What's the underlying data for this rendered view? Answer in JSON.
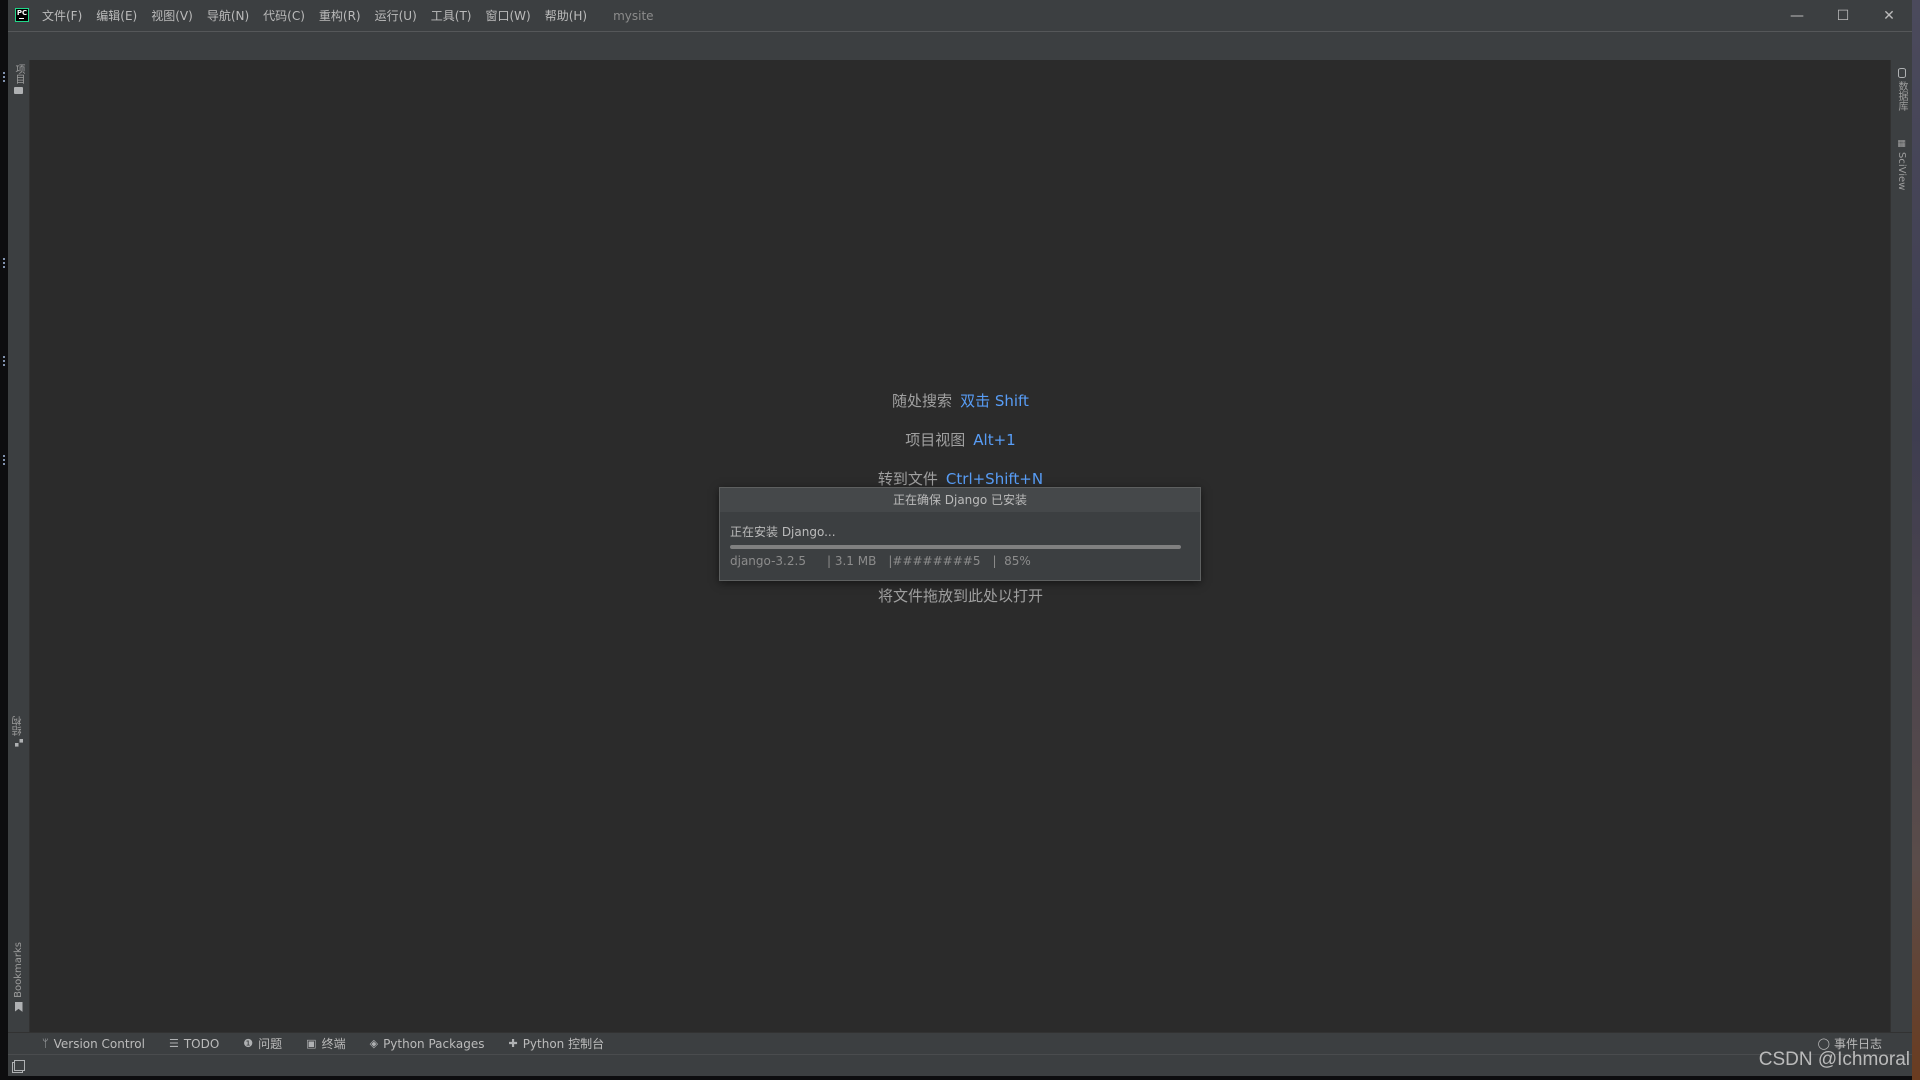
{
  "titlebar": {
    "logo_text": "PC",
    "menu": [
      "文件(F)",
      "编辑(E)",
      "视图(V)",
      "导航(N)",
      "代码(C)",
      "重构(R)",
      "运行(U)",
      "工具(T)",
      "窗口(W)",
      "帮助(H)"
    ],
    "project_name": "mysite",
    "controls": {
      "minimize": "—",
      "maximize": "☐",
      "close": "✕"
    }
  },
  "left_stripe": {
    "top": {
      "label": "项目",
      "icon": "folder-icon"
    },
    "bottom": [
      {
        "label": "结构",
        "icon": "structure-icon"
      },
      {
        "label": "Bookmarks",
        "icon": "bookmark-icon"
      }
    ]
  },
  "right_stripe": [
    {
      "label": "数据库",
      "icon": "database-icon"
    },
    {
      "label": "SciView",
      "icon": "grid-icon"
    }
  ],
  "editor_hints": [
    {
      "label": "随处搜索",
      "shortcut": "双击 Shift"
    },
    {
      "label": "项目视图",
      "shortcut": "Alt+1"
    },
    {
      "label": "转到文件",
      "shortcut": "Ctrl+Shift+N"
    },
    {
      "label": "将文件拖放到此处以打开",
      "shortcut": ""
    }
  ],
  "dialog": {
    "title": "正在确保 Django 已安装",
    "status": "正在安装 Django...",
    "progress_percent": 100,
    "detail": {
      "package": "django-3.2.5",
      "size": "| 3.1 MB",
      "bar": "|########5",
      "percent": "|  85%"
    }
  },
  "bottom_toolbar": [
    {
      "label": "Version Control",
      "icon": "branch-icon",
      "glyph": "ᛘ"
    },
    {
      "label": "TODO",
      "icon": "list-icon",
      "glyph": "☰"
    },
    {
      "label": "问题",
      "icon": "problems-icon",
      "glyph": "❶"
    },
    {
      "label": "终端",
      "icon": "terminal-icon",
      "glyph": "▣"
    },
    {
      "label": "Python Packages",
      "icon": "layers-icon",
      "glyph": "◈"
    },
    {
      "label": "Python 控制台",
      "icon": "python-icon",
      "glyph": "✚"
    }
  ],
  "event_log": {
    "label": "事件日志",
    "glyph": "◯"
  },
  "watermark": "CSDN @Ichmoral"
}
